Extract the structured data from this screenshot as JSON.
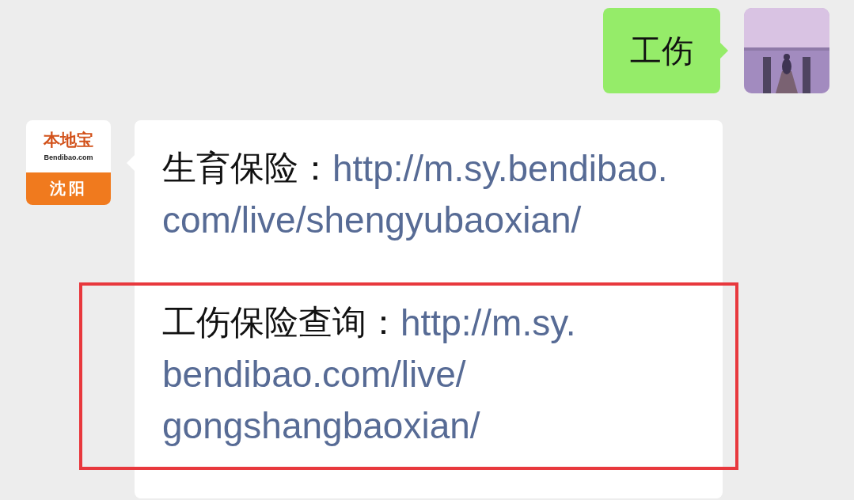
{
  "messages": [
    {
      "kind": "sent",
      "text": "工伤"
    },
    {
      "kind": "received",
      "avatar": {
        "kind": "logo",
        "brand": "本地宝",
        "site": "Bendibao.com",
        "city": "沈阳"
      },
      "paragraphs": [
        {
          "label": "生育保险：",
          "link_lines": [
            "http://m.sy.bendibao.",
            "com/live/shengyubaoxian/"
          ],
          "highlighted": false
        },
        {
          "label": "工伤保险查询：",
          "link_lines": [
            "http://m.sy.",
            "bendibao.com/live/",
            "gongshangbaoxian/"
          ],
          "highlighted": true
        }
      ]
    }
  ]
}
